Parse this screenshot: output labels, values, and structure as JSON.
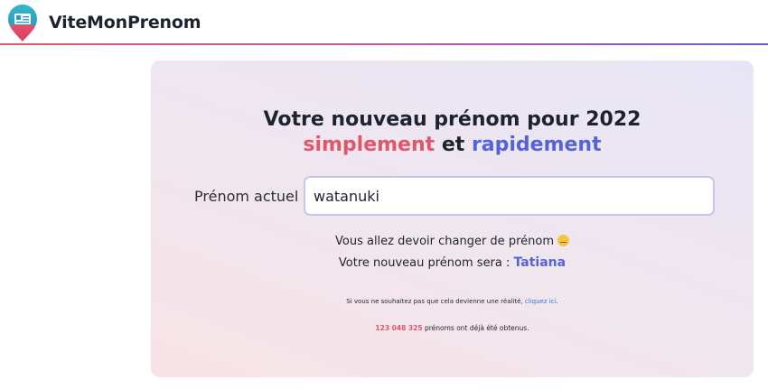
{
  "header": {
    "brand": "ViteMonPrenom",
    "logo_icon": "id-card-pin-icon"
  },
  "hero": {
    "title": "Votre nouveau prénom pour 2022",
    "subtitle_word1": "simplement",
    "subtitle_and": "et",
    "subtitle_word2": "rapidement"
  },
  "form": {
    "label": "Prénom actuel :",
    "input_value": "watanuki"
  },
  "result": {
    "message": "Vous allez devoir changer de prénom",
    "emoji_icon": "pensive-face-icon",
    "new_name_prefix": "Votre nouveau prénom sera :",
    "new_name": "Tatiana"
  },
  "footer": {
    "note_text": "Si vous ne souhaitez pas que cela devienne une réalité,",
    "note_link": "cliquez ici",
    "note_end": ".",
    "count": "123 048 325",
    "count_suffix": "prénoms ont déjà été obtenus."
  },
  "colors": {
    "accent_red": "#e0566b",
    "accent_blue": "#5563d8",
    "link": "#3a74d8"
  }
}
